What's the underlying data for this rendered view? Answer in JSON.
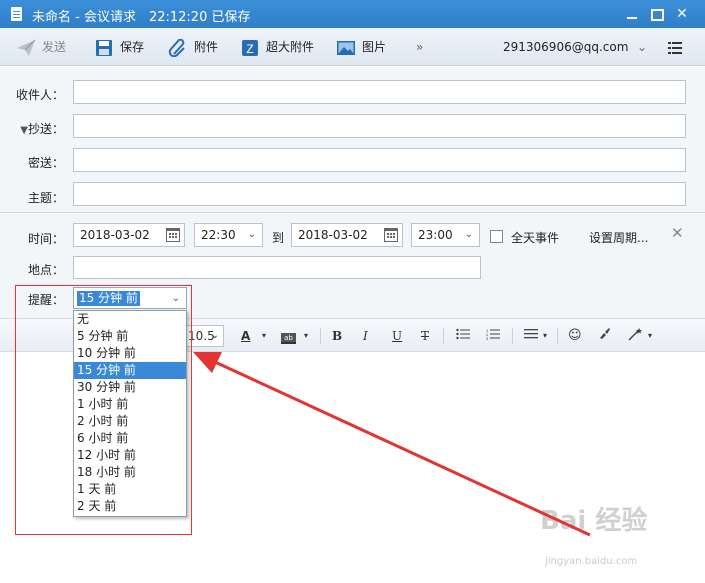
{
  "window": {
    "title": "未命名 - 会议请求　22:12:20 已保存"
  },
  "toolbar": {
    "send_label": "发送",
    "save_label": "保存",
    "attach_label": "附件",
    "big_attach_label": "超大附件",
    "picture_label": "图片",
    "more_label": "»",
    "account": "291306906@qq.com"
  },
  "fields": {
    "to_label": "收件人：",
    "cc_label": "抄送：",
    "bcc_label": "密送：",
    "subject_label": "主题："
  },
  "time": {
    "label": "时间：",
    "start_date": "2018-03-02",
    "start_time": "22:30",
    "to_label": "到",
    "end_date": "2018-03-02",
    "end_time": "23:00",
    "all_day_label": "全天事件",
    "recurrence_label": "设置周期..."
  },
  "location": {
    "label": "地点："
  },
  "reminder": {
    "label": "提醒：",
    "selected": "15 分钟 前",
    "options": [
      "无",
      "5 分钟 前",
      "10 分钟 前",
      "15 分钟 前",
      "30 分钟 前",
      "1 小时 前",
      "2 小时 前",
      "6 小时 前",
      "12 小时 前",
      "18 小时 前",
      "1 天 前",
      "2 天 前"
    ]
  },
  "editor_toolbar": {
    "font_size": "10.5",
    "bold": "B",
    "italic": "I",
    "underline": "U",
    "strike": "T"
  },
  "watermark": {
    "text": "Bai 经验",
    "sub": "jingyan.baidu.com"
  },
  "colors": {
    "titlebar": "#3c8fd8",
    "selection": "#3a88d8",
    "annotation": "#e33333"
  }
}
